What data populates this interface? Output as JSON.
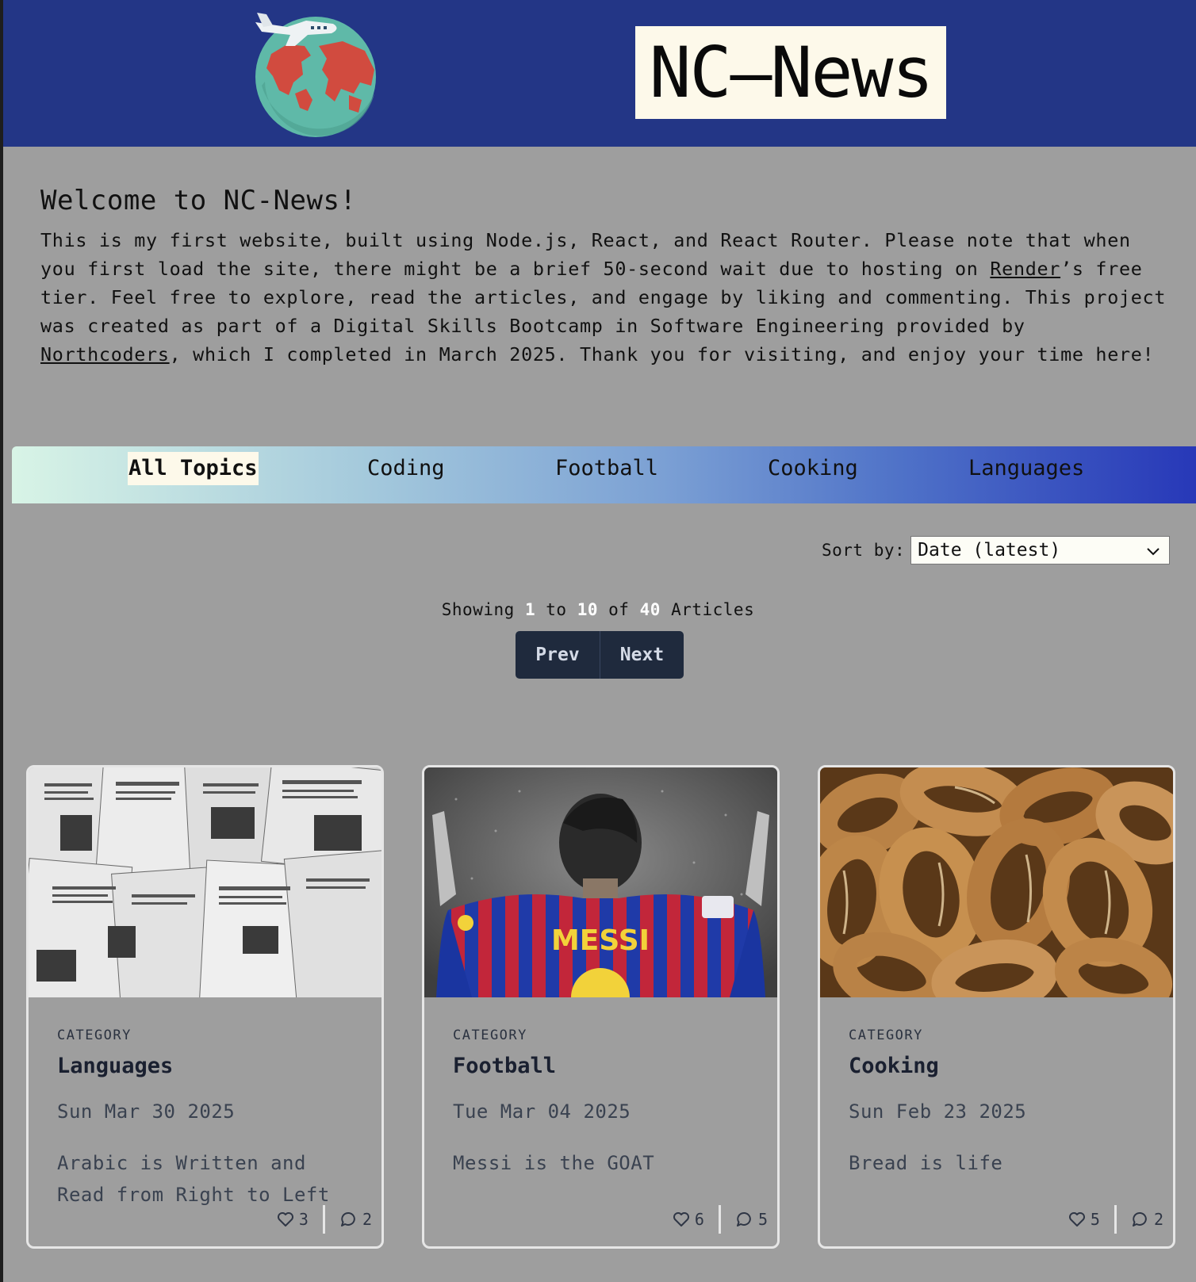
{
  "header": {
    "title": "NC–News",
    "logo_icon": "globe-airplane-icon"
  },
  "welcome": {
    "heading": "Welcome to NC-News!",
    "p1": "This is my first website, built using Node.js, React, and React Router. Please note that when you first load the site, there might be a brief 50-second wait due to hosting on ",
    "link1": "Render",
    "p2": "’s free tier. Feel free to explore, read the articles, and engage by liking and commenting. This project was created as part of a Digital Skills Bootcamp in Software Engineering provided by ",
    "link2": "Northcoders",
    "p3": ", which I completed in March 2025. Thank you for visiting, and enjoy your time here!"
  },
  "topics": [
    {
      "label": "All Topics",
      "active": true
    },
    {
      "label": "Coding"
    },
    {
      "label": "Football"
    },
    {
      "label": "Cooking"
    },
    {
      "label": "Languages"
    }
  ],
  "sort": {
    "label": "Sort by:",
    "value": "Date (latest)"
  },
  "pagination": {
    "showing": "Showing",
    "from": "1",
    "to_word": "to",
    "to": "10",
    "of_word": "of",
    "total": "40",
    "unit": "Articles",
    "prev": "Prev",
    "next": "Next"
  },
  "cards": [
    {
      "category_label": "CATEGORY",
      "category": "Languages",
      "date": "Sun Mar 30 2025",
      "title": "Arabic is Written and Read from Right to Left",
      "likes": "3",
      "comments": "2",
      "image": "newspapers"
    },
    {
      "category_label": "CATEGORY",
      "category": "Football",
      "date": "Tue Mar 04 2025",
      "title": "Messi is the GOAT",
      "likes": "6",
      "comments": "5",
      "image": "footballer-back",
      "shirt_text": "MESSI"
    },
    {
      "category_label": "CATEGORY",
      "category": "Cooking",
      "date": "Sun Feb 23 2025",
      "title": "Bread is life",
      "likes": "5",
      "comments": "2",
      "image": "bread-rings"
    }
  ],
  "colors": {
    "header_bg": "#233686",
    "page_bg": "#9e9e9e",
    "title_bg": "#fdf9ea",
    "pager_bg": "#1f2a3d"
  }
}
